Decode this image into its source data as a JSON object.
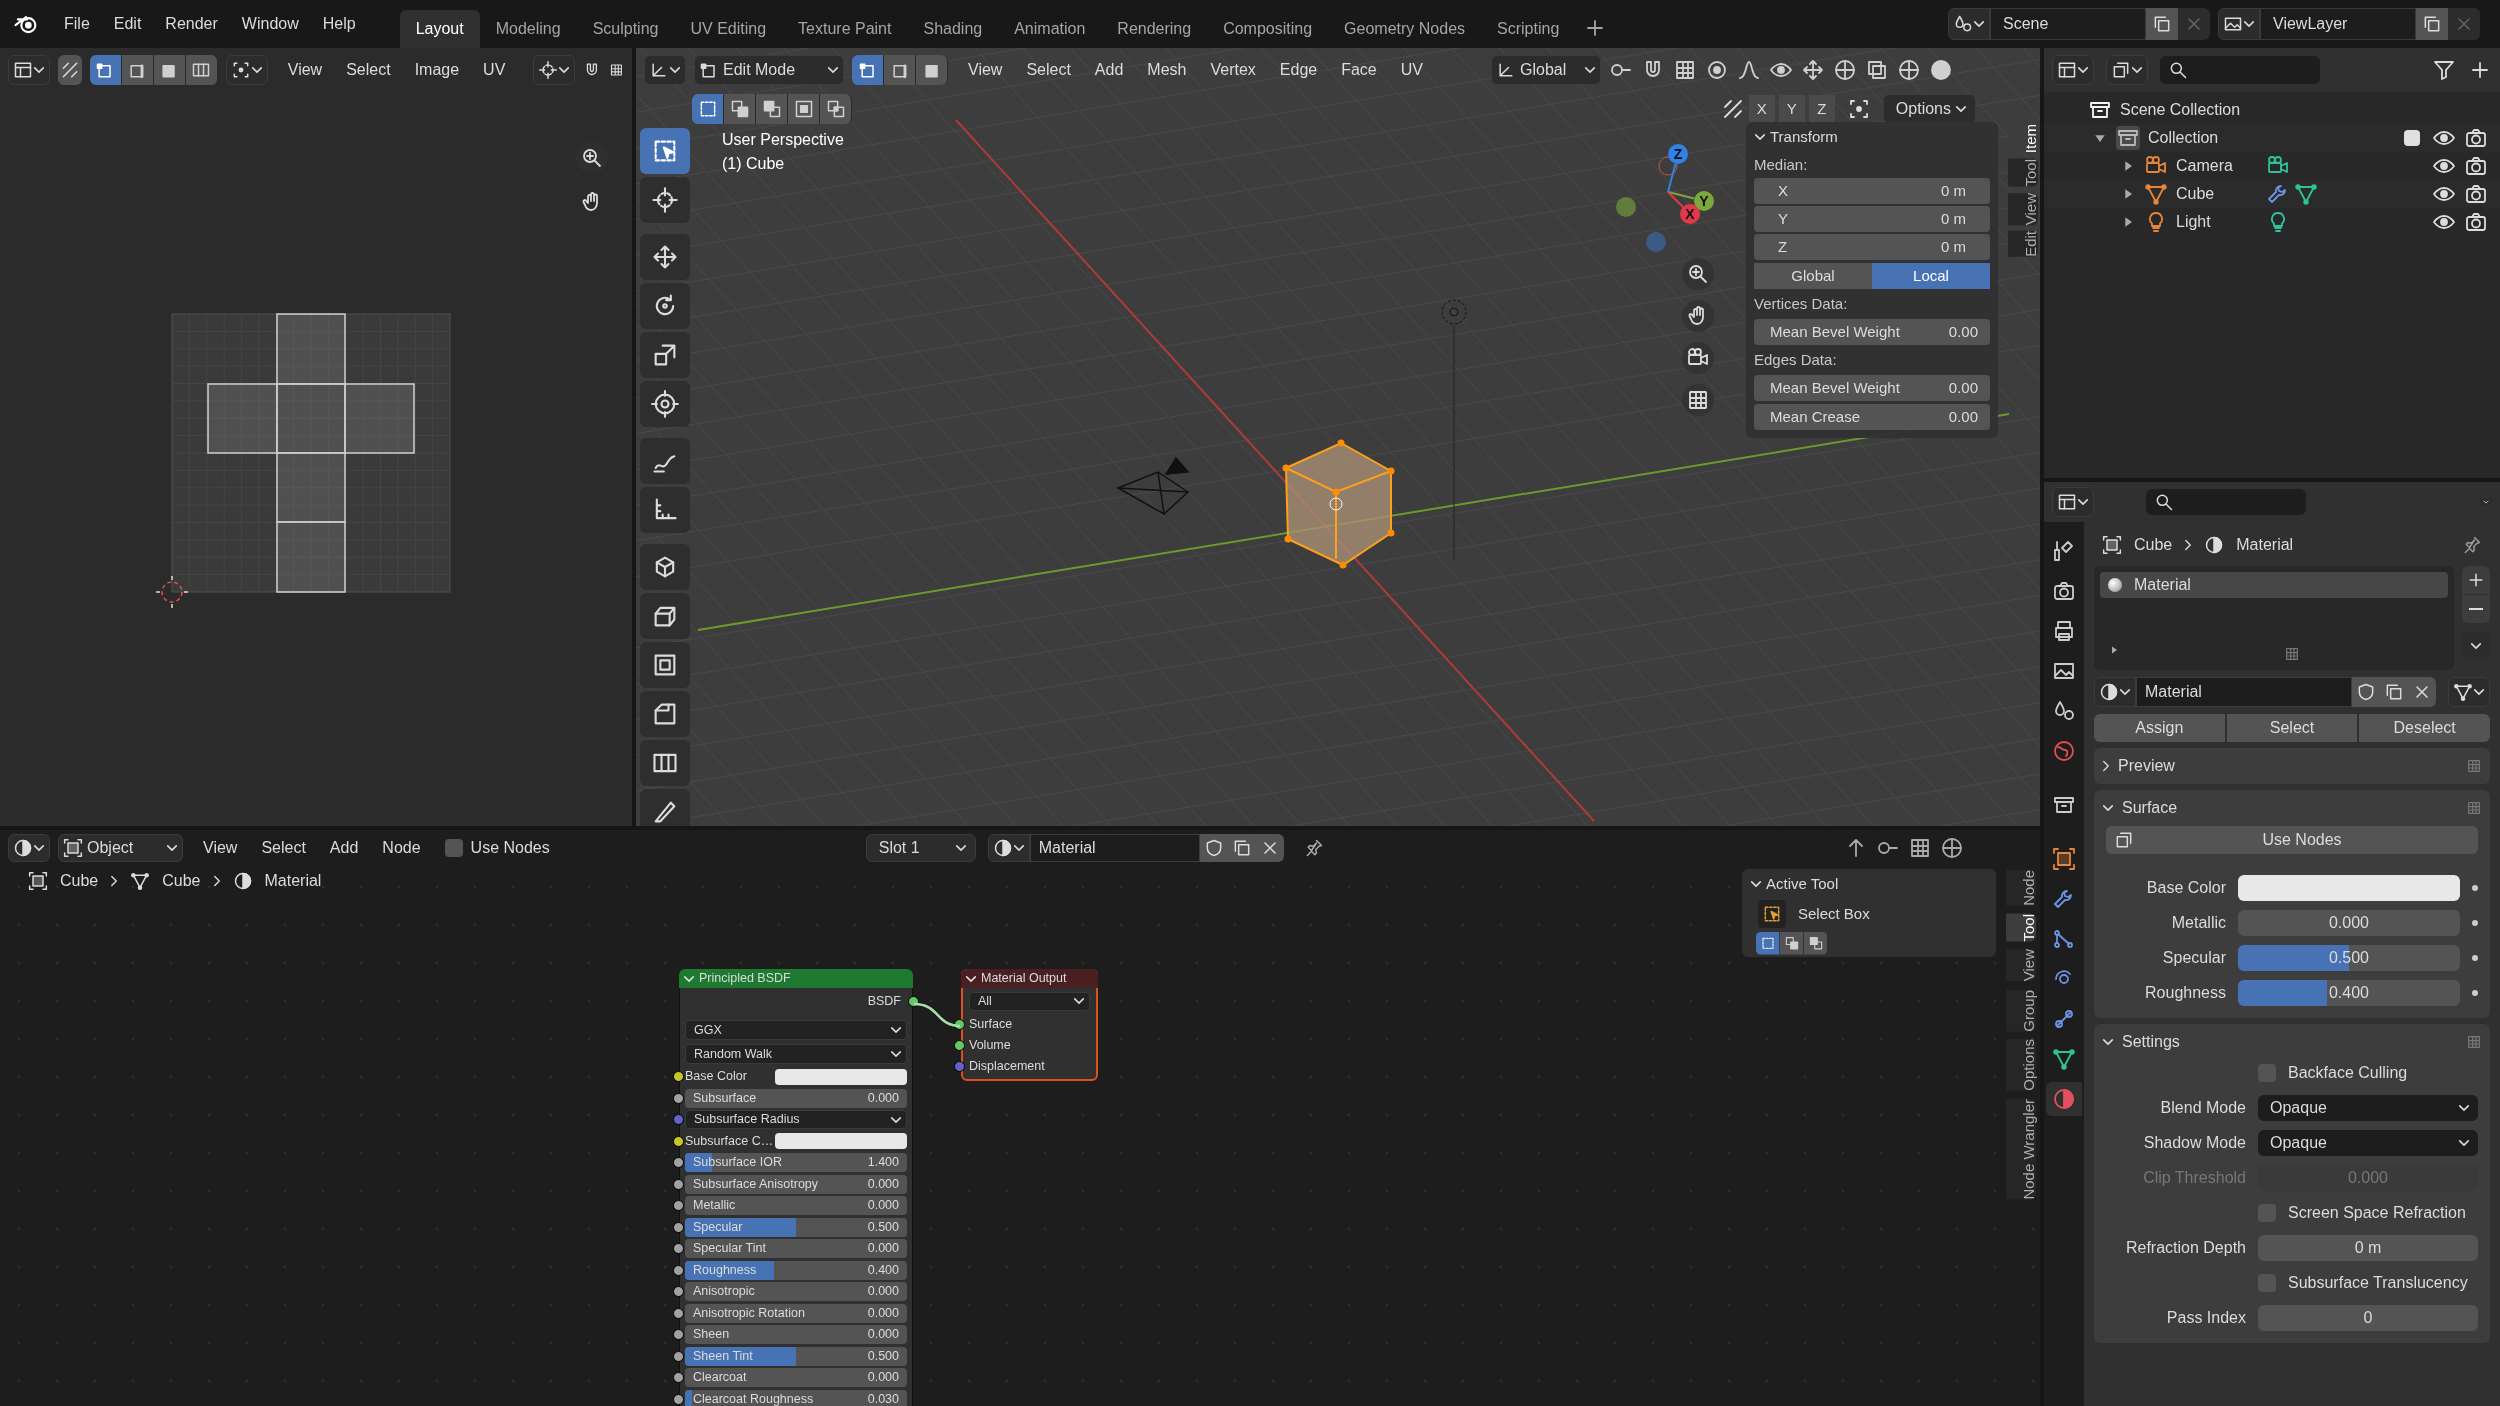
{
  "topbar": {
    "menus": [
      "File",
      "Edit",
      "Render",
      "Window",
      "Help"
    ],
    "workspaces": [
      {
        "label": "Layout",
        "selected": true
      },
      {
        "label": "Modeling",
        "selected": false
      },
      {
        "label": "Sculpting",
        "selected": false
      },
      {
        "label": "UV Editing",
        "selected": false
      },
      {
        "label": "Texture Paint",
        "selected": false
      },
      {
        "label": "Shading",
        "selected": false
      },
      {
        "label": "Animation",
        "selected": false
      },
      {
        "label": "Rendering",
        "selected": false
      },
      {
        "label": "Compositing",
        "selected": false
      },
      {
        "label": "Geometry Nodes",
        "selected": false
      },
      {
        "label": "Scripting",
        "selected": false
      }
    ],
    "scene": "Scene",
    "view_layer": "ViewLayer"
  },
  "uv_editor": {
    "select_modes": [
      {
        "selected": true
      },
      {
        "selected": false
      },
      {
        "selected": false
      },
      {
        "selected": false
      }
    ],
    "menus": [
      "View",
      "Select",
      "Image",
      "UV"
    ]
  },
  "viewport": {
    "mode": "Edit Mode",
    "select_modes": [
      {
        "selected": true
      },
      {
        "selected": false
      },
      {
        "selected": false
      }
    ],
    "menus": [
      "View",
      "Select",
      "Add",
      "Mesh",
      "Vertex",
      "Edge",
      "Face",
      "UV"
    ],
    "orientation": "Global",
    "box_modes": [
      {
        "selected": true
      },
      {
        "selected": false
      },
      {
        "selected": false
      },
      {
        "selected": false
      },
      {
        "selected": false
      }
    ],
    "axes": [
      "X",
      "Y",
      "Z"
    ],
    "options": "Options",
    "overlay": [
      "User Perspective",
      "(1) Cube"
    ],
    "gizmo_axes": [
      "Z",
      "Y",
      "X"
    ],
    "tools": [
      {
        "selected": true
      },
      {
        "selected": false
      },
      {
        "selected": false
      },
      {
        "selected": false
      },
      {
        "selected": false
      },
      {
        "selected": false
      },
      {
        "selected": false
      },
      {
        "selected": false
      },
      {
        "selected": false
      },
      {
        "selected": false
      },
      {
        "selected": false
      },
      {
        "selected": false
      },
      {
        "selected": false
      },
      {
        "selected": false
      }
    ],
    "tabs": [
      {
        "label": "Item",
        "selected": true
      },
      {
        "label": "Tool",
        "selected": false
      },
      {
        "label": "View",
        "selected": false
      },
      {
        "label": "Edit",
        "selected": false
      }
    ],
    "transform": {
      "title": "Transform",
      "median_label": "Median:",
      "coords": [
        {
          "label": "X",
          "value": "0 m"
        },
        {
          "label": "Y",
          "value": "0 m"
        },
        {
          "label": "Z",
          "value": "0 m"
        }
      ],
      "spaces": [
        {
          "label": "Global",
          "selected": false
        },
        {
          "label": "Local",
          "selected": true
        }
      ],
      "sections": [
        {
          "label": "Vertices Data:",
          "fields": [
            {
              "label": "Mean Bevel Weight",
              "value": "0.00"
            }
          ]
        },
        {
          "label": "Edges Data:",
          "fields": [
            {
              "label": "Mean Bevel Weight",
              "value": "0.00"
            },
            {
              "label": "Mean Crease",
              "value": "0.00"
            }
          ]
        }
      ]
    }
  },
  "outliner": {
    "tree": [
      {
        "kind": "scene",
        "label": "Scene Collection",
        "children": [
          {
            "kind": "collection",
            "label": "Collection",
            "expanded": true,
            "checked": true,
            "children": [
              {
                "kind": "camera",
                "label": "Camera",
                "expanded": false
              },
              {
                "kind": "mesh",
                "label": "Cube",
                "expanded": false
              },
              {
                "kind": "light",
                "label": "Light",
                "expanded": false
              }
            ]
          }
        ]
      }
    ]
  },
  "properties": {
    "tabs": [
      {
        "selected": false
      },
      {
        "selected": false
      },
      {
        "selected": false
      },
      {
        "selected": false
      },
      {
        "selected": false
      },
      {
        "selected": false
      },
      {
        "selected": false
      },
      {
        "selected": false
      },
      {
        "selected": false
      },
      {
        "selected": false
      },
      {
        "selected": false
      },
      {
        "selected": false
      },
      {
        "selected": false
      },
      {
        "selected": true
      }
    ],
    "breadcrumb": [
      "Cube",
      "Material"
    ],
    "slots": [
      {
        "label": "Material",
        "selected": true
      }
    ],
    "material": "Material",
    "actions": [
      "Assign",
      "Select",
      "Deselect"
    ],
    "panels": [
      {
        "title": "Preview",
        "expanded": false
      },
      {
        "title": "Surface",
        "expanded": true,
        "button": "Use Nodes",
        "rows": [
          {
            "kind": "color",
            "label": "Base Color",
            "color": "#e8e8e8"
          },
          {
            "kind": "slider",
            "label": "Metallic",
            "value": "0.000",
            "level": 0
          },
          {
            "kind": "slider",
            "label": "Specular",
            "value": "0.500",
            "level": 0.5
          },
          {
            "kind": "slider",
            "label": "Roughness",
            "value": "0.400",
            "level": 0.4
          }
        ]
      },
      {
        "title": "Settings",
        "expanded": true,
        "rows": [
          {
            "kind": "checkbox",
            "label": "Backface Culling",
            "checked": false
          },
          {
            "kind": "dropdown",
            "label": "Blend Mode",
            "value": "Opaque"
          },
          {
            "kind": "dropdown",
            "label": "Shadow Mode",
            "value": "Opaque"
          },
          {
            "kind": "number",
            "label": "Clip Threshold",
            "value": "0.000",
            "disabled": true
          },
          {
            "kind": "checkbox",
            "label": "Screen Space Refraction",
            "checked": false
          },
          {
            "kind": "number",
            "label": "Refraction Depth",
            "value": "0 m",
            "disabled": false
          },
          {
            "kind": "checkbox",
            "label": "Subsurface Translucency",
            "checked": false
          },
          {
            "kind": "number",
            "label": "Pass Index",
            "value": "0",
            "disabled": false
          }
        ]
      }
    ]
  },
  "node_editor": {
    "editor_type": "Object",
    "menus": [
      "View",
      "Select",
      "Add",
      "Node"
    ],
    "use_nodes": {
      "label": "Use Nodes",
      "checked": false
    },
    "slot": "Slot 1",
    "material": "Material",
    "breadcrumb": [
      "Cube",
      "Cube",
      "Material"
    ],
    "nodes": [
      {
        "kind": "principled",
        "title": "Principled BSDF",
        "output": "BSDF",
        "dropdowns": [
          "GGX",
          "Random Walk"
        ],
        "inputs": [
          {
            "kind": "color",
            "label": "Base Color",
            "color": "#c7c729"
          },
          {
            "kind": "slider",
            "label": "Subsurface",
            "value": "0.000",
            "level": 0,
            "color": "#a1a1a1"
          },
          {
            "kind": "dropdown",
            "label": "Subsurface Radius",
            "color": "#6363c7"
          },
          {
            "kind": "color",
            "label": "Subsurface C…",
            "color": "#c7c729"
          },
          {
            "kind": "slider",
            "label": "Subsurface IOR",
            "value": "1.400",
            "level": 0.12,
            "color": "#a1a1a1"
          },
          {
            "kind": "slider",
            "label": "Subsurface Anisotropy",
            "value": "0.000",
            "level": 0,
            "color": "#a1a1a1"
          },
          {
            "kind": "slider",
            "label": "Metallic",
            "value": "0.000",
            "level": 0,
            "color": "#a1a1a1"
          },
          {
            "kind": "slider",
            "label": "Specular",
            "value": "0.500",
            "level": 0.5,
            "color": "#a1a1a1"
          },
          {
            "kind": "slider",
            "label": "Specular Tint",
            "value": "0.000",
            "level": 0,
            "color": "#a1a1a1"
          },
          {
            "kind": "slider",
            "label": "Roughness",
            "value": "0.400",
            "level": 0.4,
            "color": "#a1a1a1"
          },
          {
            "kind": "slider",
            "label": "Anisotropic",
            "value": "0.000",
            "level": 0,
            "color": "#a1a1a1"
          },
          {
            "kind": "slider",
            "label": "Anisotropic Rotation",
            "value": "0.000",
            "level": 0,
            "color": "#a1a1a1"
          },
          {
            "kind": "slider",
            "label": "Sheen",
            "value": "0.000",
            "level": 0,
            "color": "#a1a1a1"
          },
          {
            "kind": "slider",
            "label": "Sheen Tint",
            "value": "0.500",
            "level": 0.5,
            "color": "#a1a1a1"
          },
          {
            "kind": "slider",
            "label": "Clearcoat",
            "value": "0.000",
            "level": 0,
            "color": "#a1a1a1"
          },
          {
            "kind": "slider",
            "label": "Clearcoat Roughness",
            "value": "0.030",
            "level": 0.03,
            "color": "#a1a1a1"
          }
        ]
      },
      {
        "kind": "output",
        "title": "Material Output",
        "target": "All",
        "inputs": [
          {
            "label": "Surface",
            "color": "#63c763"
          },
          {
            "label": "Volume",
            "color": "#63c763"
          },
          {
            "label": "Displacement",
            "color": "#6363c7"
          }
        ]
      }
    ],
    "tabs": [
      {
        "label": "Node",
        "selected": false
      },
      {
        "label": "Tool",
        "selected": true
      },
      {
        "label": "View",
        "selected": false
      },
      {
        "label": "Group",
        "selected": false
      },
      {
        "label": "Options",
        "selected": false
      },
      {
        "label": "Node Wrangler",
        "selected": false
      }
    ],
    "active_tool": {
      "title": "Active Tool",
      "tool": "Select Box",
      "modes": [
        {
          "selected": true
        },
        {
          "selected": false
        },
        {
          "selected": false
        }
      ]
    }
  }
}
